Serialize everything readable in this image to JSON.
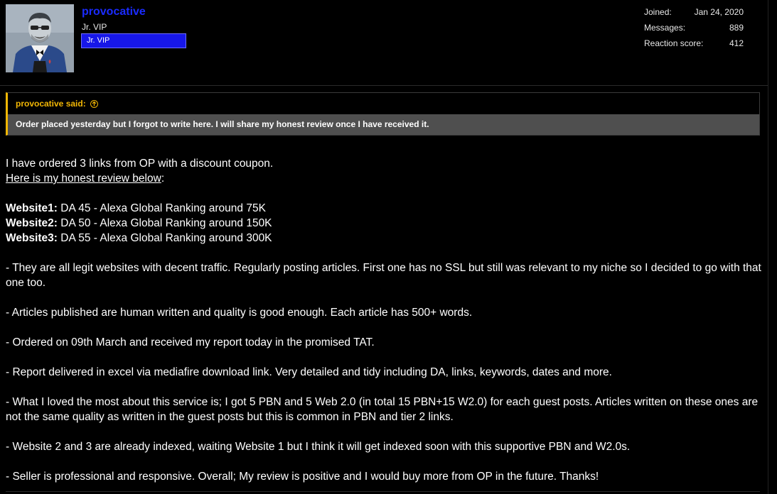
{
  "user": {
    "name": "provocative",
    "title": "Jr. VIP",
    "banner": "Jr. VIP",
    "stats": [
      {
        "label": "Joined:",
        "value": "Jan 24, 2020"
      },
      {
        "label": "Messages:",
        "value": "889"
      },
      {
        "label": "Reaction score:",
        "value": "412"
      }
    ]
  },
  "quote": {
    "author_said": "provocative said:",
    "text": "Order placed yesterday but I forgot to write here. I will share my honest review once I have received it."
  },
  "post": {
    "intro": "I have ordered 3 links from OP with a discount coupon.",
    "review_link": "Here is my honest review below",
    "review_colon": ":",
    "websites": [
      {
        "name": "Website1:",
        "details": " DA 45 - Alexa Global Ranking around 75K"
      },
      {
        "name": "Website2:",
        "details": " DA 50 - Alexa Global Ranking around 150K"
      },
      {
        "name": "Website3:",
        "details": " DA 55 - Alexa Global Ranking around 300K"
      }
    ],
    "points": [
      "- They are all legit websites with decent traffic. Regularly posting articles. First one has no SSL but still was relevant to my niche so I decided to go with that one too.",
      "- Articles published are human written and quality is good enough. Each article has 500+ words.",
      "- Ordered on 09th March and received my report today in the promised TAT.",
      "- Report delivered in excel via mediafire download link. Very detailed and tidy including DA, links, keywords, dates and more.",
      "- What I loved the most about this service is; I got 5 PBN and 5 Web 2.0 (in total 15 PBN+15 W2.0) for each guest posts. Articles written on these ones are not the same quality as written in the guest posts but this is common in PBN and tier 2 links.",
      "- Website 2 and 3 are already indexed, waiting Website 1 but I think it will get indexed soon with this supportive PBN and W2.0s.",
      "- Seller is professional and responsive. Overall; My review is positive and I would buy more from OP in the future. Thanks!"
    ]
  },
  "colors": {
    "username": "#1a2bff",
    "quote_accent": "#f2b705",
    "banner": "#1717e8"
  }
}
